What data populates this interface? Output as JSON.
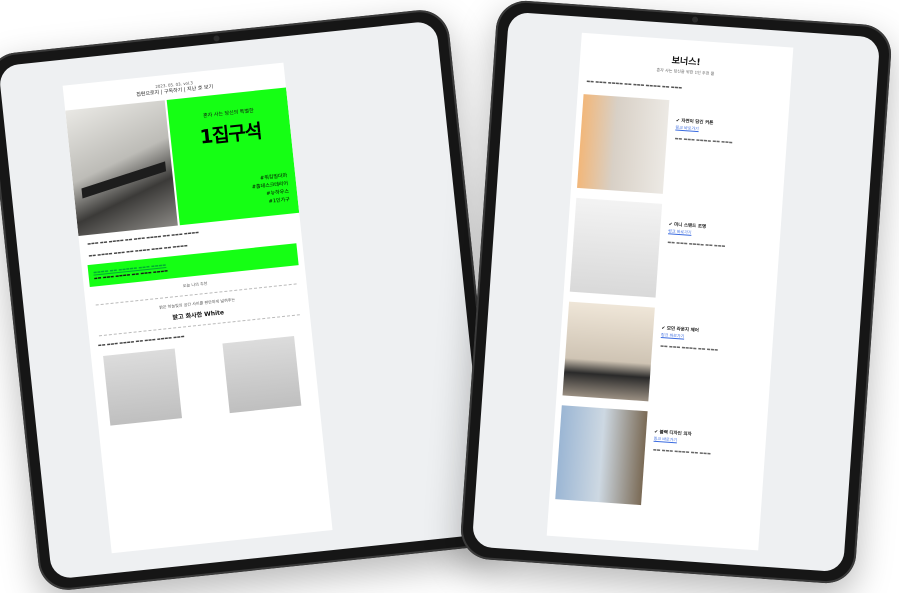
{
  "left": {
    "date": "2023. 05. 03. vol.3",
    "header": "집편으로지 | 구독하기 | 지난 호 보기",
    "hero_sub": "혼자 사는 당신의 특별한",
    "hero_title": "1집구석",
    "hero_tags": [
      "#워킹밀더마",
      "#홈데스크테리어",
      "#뉴하우스",
      "#1인가구"
    ],
    "section_label": "오늘 나의 추천",
    "feature_line": "밝은 하늘빛의 공간 사이를 편안하게 넓혀주는",
    "feature_title": "밝고 화사한 White",
    "colors": {
      "green": "#15ff14"
    }
  },
  "right": {
    "title": "보너스!",
    "subtitle": "혼자 사는 당신을 위한 1인 추천 품",
    "items": [
      {
        "name": "✔ 자연이 담긴 커튼",
        "link": "링크 바로가기"
      },
      {
        "name": "✔ 미니 스탠드 조명",
        "link": "링크 바로가기"
      },
      {
        "name": "✔ 모던 라운지 체어",
        "link": "링크 바로가기"
      },
      {
        "name": "✔ 블랙 디자인 의자",
        "link": "링크 바로가기"
      }
    ]
  }
}
